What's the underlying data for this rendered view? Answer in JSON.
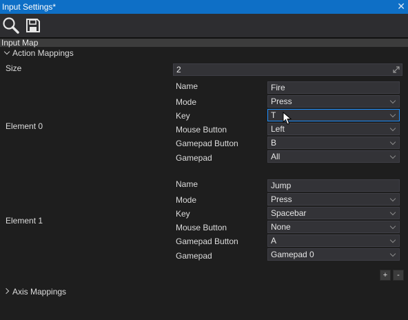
{
  "window": {
    "title": "Input Settings*",
    "close": "✕"
  },
  "toolbar": {
    "search_icon": "search-icon",
    "save_icon": "save-icon"
  },
  "section": {
    "title": "Input Map"
  },
  "action_mappings": {
    "label": "Action Mappings",
    "size_label": "Size",
    "size_value": "2",
    "elements": [
      {
        "label": "Element 0",
        "fields": [
          {
            "label": "Name",
            "value": "Fire"
          },
          {
            "label": "Mode",
            "value": "Press"
          },
          {
            "label": "Key",
            "value": "T"
          },
          {
            "label": "Mouse Button",
            "value": "Left"
          },
          {
            "label": "Gamepad Button",
            "value": "B"
          },
          {
            "label": "Gamepad",
            "value": "All"
          }
        ]
      },
      {
        "label": "Element 1",
        "fields": [
          {
            "label": "Name",
            "value": "Jump"
          },
          {
            "label": "Mode",
            "value": "Press"
          },
          {
            "label": "Key",
            "value": "Spacebar"
          },
          {
            "label": "Mouse Button",
            "value": "None"
          },
          {
            "label": "Gamepad Button",
            "value": "A"
          },
          {
            "label": "Gamepad",
            "value": "Gamepad 0"
          }
        ]
      }
    ],
    "add_label": "+",
    "remove_label": "-"
  },
  "axis_mappings": {
    "label": "Axis Mappings"
  },
  "colors": {
    "titlebar": "#0e6fc6",
    "focus": "#1e90ff",
    "background": "#1e1e1e"
  }
}
